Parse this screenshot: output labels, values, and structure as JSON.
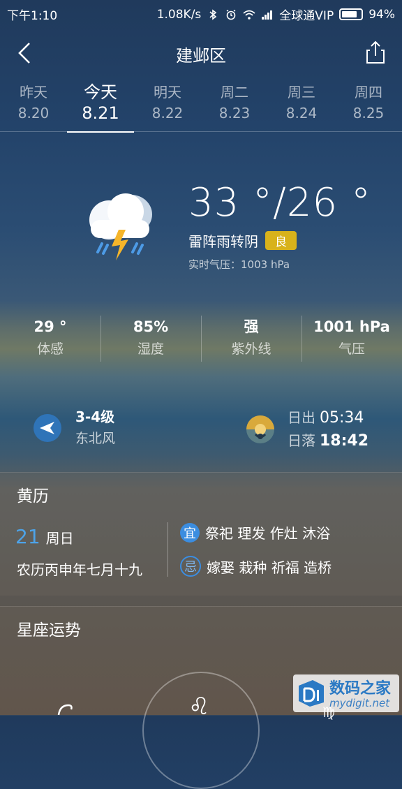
{
  "statusbar": {
    "time": "下午1:10",
    "speed": "1.08K/s",
    "carrier": "全球通VIP",
    "battery": "94%",
    "battery_level": 0.94
  },
  "header": {
    "title": "建邺区"
  },
  "days": [
    {
      "name": "昨天",
      "date": "8.20"
    },
    {
      "name": "今天",
      "date": "8.21"
    },
    {
      "name": "明天",
      "date": "8.22"
    },
    {
      "name": "周二",
      "date": "8.23"
    },
    {
      "name": "周三",
      "date": "8.24"
    },
    {
      "name": "周四",
      "date": "8.25"
    }
  ],
  "current": {
    "temp": "33 °/26 °",
    "condition": "雷阵雨转阴",
    "aqi": "良",
    "pressure_realtime": "实时气压：1003 hPa"
  },
  "stats": [
    {
      "value": "29 °",
      "label": "体感"
    },
    {
      "value": "85%",
      "label": "湿度"
    },
    {
      "value": "强",
      "label": "紫外线"
    },
    {
      "value": "1001 hPa",
      "label": "气压"
    }
  ],
  "wind": {
    "level": "3-4级",
    "direction": "东北风"
  },
  "sun": {
    "sunrise_label": "日出",
    "sunrise": "05:34",
    "sunset_label": "日落",
    "sunset": "18:42"
  },
  "almanac": {
    "title": "黄历",
    "day": "21",
    "weekday": "周日",
    "lunar": "农历丙申年七月十九",
    "yi_badge": "宜",
    "yi": "祭祀 理发 作灶 沐浴",
    "ji_badge": "忌",
    "ji": "嫁娶 栽种 祈福 造桥"
  },
  "horoscope": {
    "title": "星座运势",
    "center_glyph": "♌",
    "right_glyph": "♍"
  },
  "watermark": {
    "text": "数码之家",
    "url": "mydigit.net"
  },
  "colors": {
    "accent": "#3b8de0",
    "aqi": "#d8b21b",
    "day_number": "#4da3e8"
  }
}
